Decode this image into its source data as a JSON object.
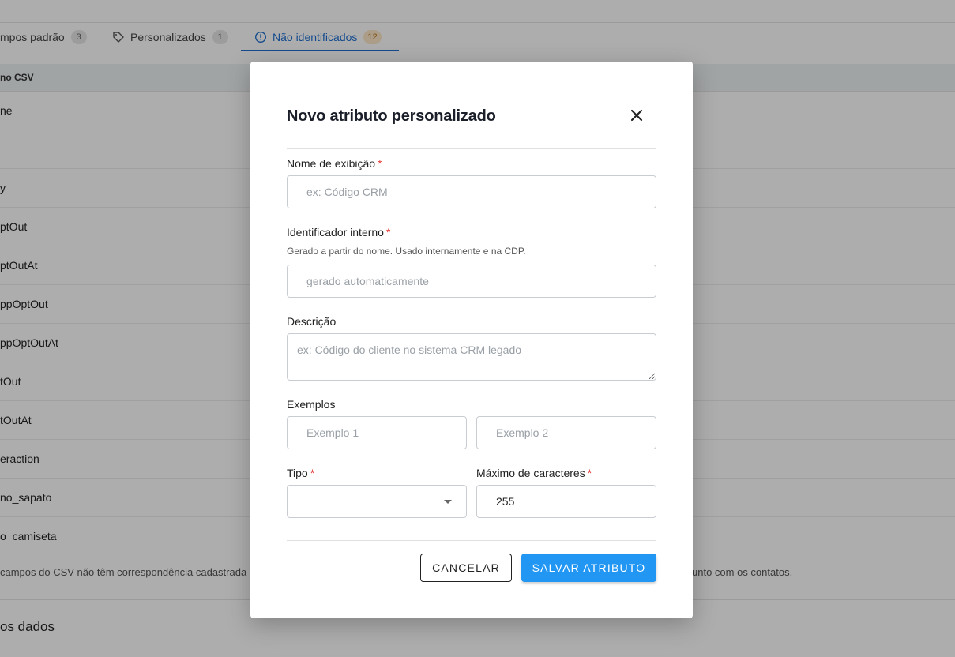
{
  "tabs": [
    {
      "label": "mpos padrão",
      "count": "3"
    },
    {
      "label": "Personalizados",
      "count": "1"
    },
    {
      "label": "Não identificados",
      "count": "12"
    }
  ],
  "table": {
    "header": "no CSV",
    "rows": [
      "ne",
      "",
      "y",
      "ptOut",
      "ptOutAt",
      "ppOptOut",
      "ppOptOutAt",
      "tOut",
      "tOutAt",
      "eraction",
      "no_sapato",
      "o_camiseta"
    ]
  },
  "footnote": {
    "left": "campos do CSV não têm correspondência cadastrada n",
    "right": "unto com os contatos."
  },
  "section_title": "os dados",
  "modal": {
    "title": "Novo atributo personalizado",
    "display_name": {
      "label": "Nome de exibição",
      "required_mark": "*",
      "placeholder": "ex: Código CRM",
      "value": ""
    },
    "internal_id": {
      "label": "Identificador interno",
      "required_mark": "*",
      "hint": "Gerado a partir do nome. Usado internamente e na CDP.",
      "placeholder": "gerado automaticamente",
      "value": ""
    },
    "description": {
      "label": "Descrição",
      "placeholder": "ex: Código do cliente no sistema CRM legado",
      "value": ""
    },
    "examples": {
      "label": "Exemplos",
      "placeholder_1": "Exemplo 1",
      "placeholder_2": "Exemplo 2"
    },
    "type": {
      "label": "Tipo",
      "required_mark": "*",
      "value": ""
    },
    "max_chars": {
      "label": "Máximo de caracteres",
      "required_mark": "*",
      "value": "255"
    },
    "cancel_label": "CANCELAR",
    "save_label": "SALVAR ATRIBUTO"
  },
  "colors": {
    "accent": "#2196f3",
    "tab_active": "#1f6fd0",
    "required": "#e53935",
    "count_badge_warning": "#fde8c8"
  },
  "icons": {
    "tab_custom": "tag-icon",
    "tab_unidentified": "alert-circle-icon",
    "close": "close-icon",
    "type_select": "caret-down-icon"
  }
}
